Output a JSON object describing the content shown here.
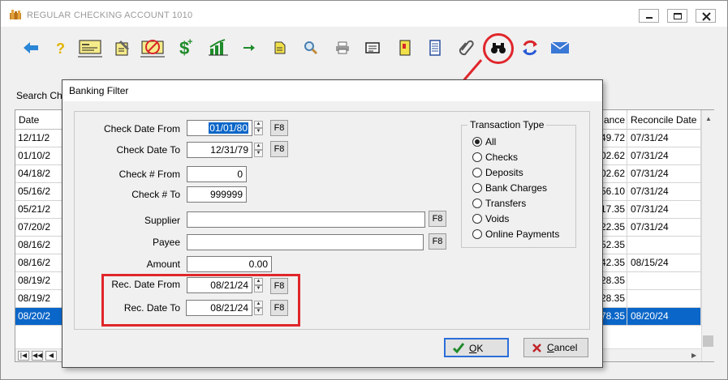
{
  "window": {
    "title": "REGULAR CHECKING ACCOUNT  1010"
  },
  "toolbar": {
    "icons": [
      "back-arrow-icon",
      "help-icon",
      "check-card-icon",
      "edit-note-icon",
      "void-check-icon",
      "dollar-add-icon",
      "chart-icon",
      "next-arrow-icon",
      "note-icon",
      "magnify-icon",
      "print-icon",
      "list-card-icon",
      "book-icon",
      "document-icon",
      "paperclip-icon",
      "binoculars-icon",
      "refresh-icon",
      "mail-icon"
    ]
  },
  "search": {
    "label": "Search Che"
  },
  "grid": {
    "headers": {
      "date": "Date",
      "balance": "ance",
      "reconcile": "Reconcile Date"
    },
    "rows": [
      {
        "date": "12/11/2",
        "balance": "49.72",
        "reconcile": "07/31/24",
        "selected": false
      },
      {
        "date": "01/10/2",
        "balance": "02.62",
        "reconcile": "07/31/24",
        "selected": false
      },
      {
        "date": "04/18/2",
        "balance": "02.62",
        "reconcile": "07/31/24",
        "selected": false
      },
      {
        "date": "05/16/2",
        "balance": "56.10",
        "reconcile": "07/31/24",
        "selected": false
      },
      {
        "date": "05/21/2",
        "balance": "17.35",
        "reconcile": "07/31/24",
        "selected": false
      },
      {
        "date": "07/20/2",
        "balance": "22.35",
        "reconcile": "07/31/24",
        "selected": false
      },
      {
        "date": "08/16/2",
        "balance": "52.35",
        "reconcile": "",
        "selected": false
      },
      {
        "date": "08/16/2",
        "balance": "42.35",
        "reconcile": "08/15/24",
        "selected": false
      },
      {
        "date": "08/19/2",
        "balance": "28.35",
        "reconcile": "",
        "selected": false
      },
      {
        "date": "08/19/2",
        "balance": "28.35",
        "reconcile": "",
        "selected": false
      },
      {
        "date": "08/20/2",
        "balance": "78.35",
        "reconcile": "08/20/24",
        "selected": true
      }
    ],
    "nav": [
      "first",
      "prev-page",
      "prev"
    ]
  },
  "dialog": {
    "title": "Banking Filter",
    "check_date_from": {
      "label": "Check Date From",
      "value": "01/01/80"
    },
    "check_date_to": {
      "label": "Check Date To",
      "value": "12/31/79"
    },
    "check_no_from": {
      "label": "Check # From",
      "value": "0"
    },
    "check_no_to": {
      "label": "Check # To",
      "value": "999999"
    },
    "supplier": {
      "label": "Supplier",
      "value": ""
    },
    "payee": {
      "label": "Payee",
      "value": ""
    },
    "amount": {
      "label": "Amount",
      "value": "0.00"
    },
    "rec_date_from": {
      "label": "Rec. Date From",
      "value": "08/21/24"
    },
    "rec_date_to": {
      "label": "Rec. Date To",
      "value": "08/21/24"
    },
    "f8_label": "F8",
    "transaction_type": {
      "title": "Transaction Type",
      "options": [
        "All",
        "Checks",
        "Deposits",
        "Bank Charges",
        "Transfers",
        "Voids",
        "Online Payments"
      ],
      "selected": "All"
    },
    "ok": {
      "mnemonic": "O",
      "rest": "K"
    },
    "cancel": {
      "mnemonic": "C",
      "rest": "ancel"
    }
  },
  "colors": {
    "highlight": "#e0262b",
    "selection": "#0a66c8",
    "ok_border": "#2b6ed8"
  }
}
